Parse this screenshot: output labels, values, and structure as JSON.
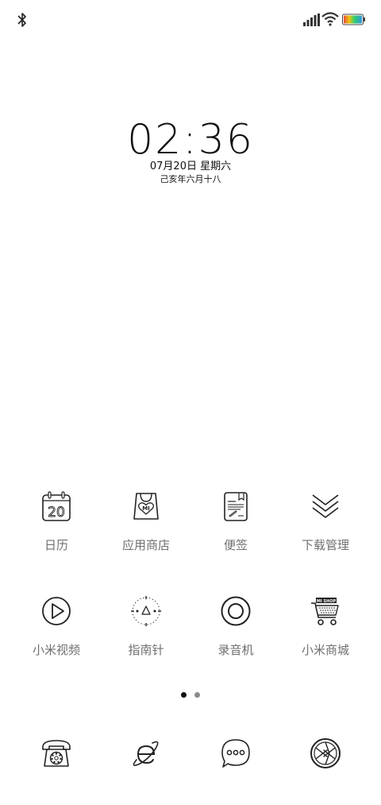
{
  "status_bar": {
    "icons": [
      "bluetooth-icon",
      "signal-icon",
      "wifi-icon",
      "battery-icon"
    ],
    "battery_colors": [
      "#e74c3c",
      "#f1c40f",
      "#2ecc71",
      "#3498db"
    ]
  },
  "lockscreen": {
    "time": "02:36",
    "date": "07月20日 星期六",
    "lunar_date": "己亥年六月十八"
  },
  "apps": [
    {
      "label": "日历",
      "icon": "calendar-icon",
      "day": "20"
    },
    {
      "label": "应用商店",
      "icon": "app-store-icon"
    },
    {
      "label": "便签",
      "icon": "notes-icon"
    },
    {
      "label": "下载管理",
      "icon": "download-manager-icon"
    },
    {
      "label": "小米视频",
      "icon": "video-play-icon"
    },
    {
      "label": "指南针",
      "icon": "compass-icon"
    },
    {
      "label": "录音机",
      "icon": "recorder-icon"
    },
    {
      "label": "小米商城",
      "icon": "shopping-cart-icon",
      "badge": "MI SHOP"
    }
  ],
  "page_indicator": {
    "current": 1,
    "total": 2
  },
  "dock": [
    {
      "icon": "phone-icon"
    },
    {
      "icon": "browser-icon"
    },
    {
      "icon": "messages-icon"
    },
    {
      "icon": "camera-icon"
    }
  ]
}
